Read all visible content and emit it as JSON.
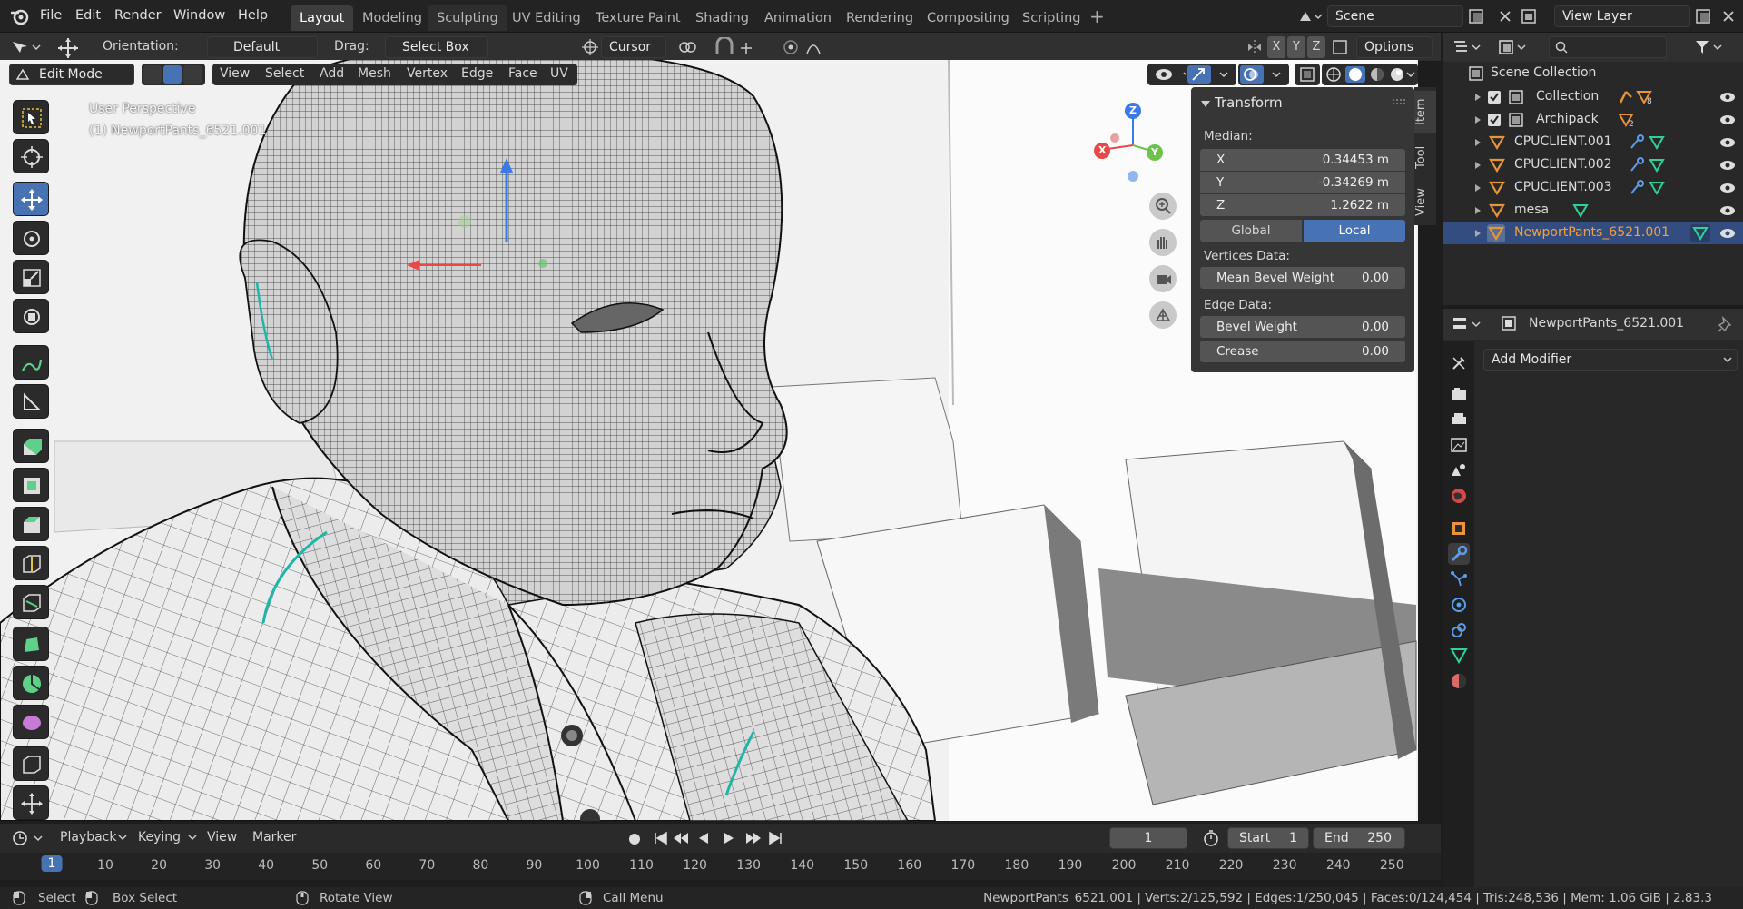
{
  "top_menu": {
    "file": "File",
    "edit": "Edit",
    "render": "Render",
    "window": "Window",
    "help": "Help"
  },
  "workspaces": [
    "Layout",
    "Modeling",
    "Sculpting",
    "UV Editing",
    "Texture Paint",
    "Shading",
    "Animation",
    "Rendering",
    "Compositing",
    "Scripting"
  ],
  "scene": {
    "name": "Scene",
    "view_layer": "View Layer"
  },
  "tool_header": {
    "orientation_label": "Orientation:",
    "orientation_value": "Default",
    "drag_label": "Drag:",
    "drag_value": "Select Box",
    "pivot_value": "Cursor",
    "options": "Options"
  },
  "viewport_header": {
    "mode": "Edit Mode",
    "menus": [
      "View",
      "Select",
      "Add",
      "Mesh",
      "Vertex",
      "Edge",
      "Face",
      "UV"
    ]
  },
  "viewport": {
    "perspective_label": "User Perspective",
    "object_label": "(1) NewportPants_6521.001",
    "gizmo": {
      "z": "Z",
      "x": "X",
      "y": "Y"
    }
  },
  "npanel": {
    "title": "Transform",
    "median_label": "Median:",
    "x_label": "X",
    "x_value": "0.34453 m",
    "y_label": "Y",
    "y_value": "-0.34269 m",
    "z_label": "Z",
    "z_value": "1.2622 m",
    "global": "Global",
    "local": "Local",
    "vertices_data": "Vertices Data:",
    "mean_bevel_label": "Mean Bevel Weight",
    "mean_bevel_value": "0.00",
    "edge_data": "Edge Data:",
    "bevel_weight_label": "Bevel Weight",
    "bevel_weight_value": "0.00",
    "crease_label": "Crease",
    "crease_value": "0.00",
    "tabs": [
      "Item",
      "Tool",
      "View"
    ]
  },
  "outliner": {
    "root": "Scene Collection",
    "items": [
      {
        "name": "Collection",
        "badge": "8"
      },
      {
        "name": "Archipack",
        "badge": "2"
      },
      {
        "name": "CPUCLIENT.001"
      },
      {
        "name": "CPUCLIENT.002"
      },
      {
        "name": "CPUCLIENT.003"
      },
      {
        "name": "mesa"
      },
      {
        "name": "NewportPants_6521.001"
      }
    ]
  },
  "properties": {
    "object_name": "NewportPants_6521.001",
    "add_modifier": "Add Modifier"
  },
  "timeline": {
    "playback": "Playback",
    "keying": "Keying",
    "view": "View",
    "marker": "Marker",
    "current_frame": "1",
    "start_label": "Start",
    "start_value": "1",
    "end_label": "End",
    "end_value": "250",
    "ticks": [
      "1",
      "10",
      "20",
      "30",
      "40",
      "50",
      "60",
      "70",
      "80",
      "90",
      "100",
      "110",
      "120",
      "130",
      "140",
      "150",
      "160",
      "170",
      "180",
      "190",
      "200",
      "210",
      "220",
      "230",
      "240",
      "250"
    ]
  },
  "statusbar": {
    "select": "Select",
    "box_select": "Box Select",
    "rotate_view": "Rotate View",
    "call_menu": "Call Menu",
    "stats": "NewportPants_6521.001 | Verts:2/125,592 | Edges:1/250,045 | Faces:0/124,454 | Tris:248,536 | Mem: 1.06 GiB | 2.83.3"
  },
  "colors": {
    "accent": "#4772b3",
    "selected_row": "#334d80",
    "object_orange": "#e8943a",
    "mesh_green": "#2fd09a"
  }
}
